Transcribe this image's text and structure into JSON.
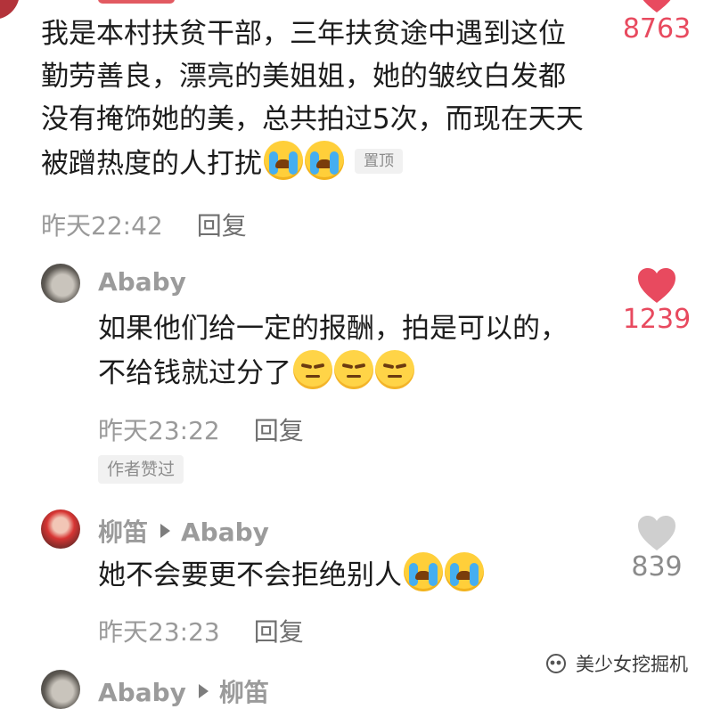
{
  "comments": [
    {
      "lines": [
        "我是本村扶贫干部，三年扶贫途中遇到这位",
        "勤劳善良，漂亮的美姐姐，她的皱纹白发都",
        "没有掩饰她的美，总共拍过5次，而现在天天",
        "被蹭热度的人打扰"
      ],
      "pin_label": "置顶",
      "time": "昨天22:42",
      "reply_label": "回复",
      "likes": "8763"
    },
    {
      "username": "Ababy",
      "lines": [
        "如果他们给一定的报酬，拍是可以的，",
        "不给钱就过分了"
      ],
      "time": "昨天23:22",
      "reply_label": "回复",
      "author_badge": "作者赞过",
      "likes": "1239"
    },
    {
      "username": "柳笛",
      "reply_to": "Ababy",
      "lines": [
        "她不会要更不会拒绝别人"
      ],
      "time": "昨天23:23",
      "reply_label": "回复",
      "likes": "839"
    },
    {
      "username": "Ababy",
      "reply_to": "柳笛"
    }
  ],
  "watermark": "美少女挖掘机",
  "icons": {
    "like_active": "heart-filled-red",
    "like_inactive": "heart-filled-gray",
    "emoji_cry": "loudly-crying-face",
    "emoji_smirk": "unamused-face",
    "watermark": "wechat-official-account-icon"
  },
  "colors": {
    "like_active": "#e84a5f",
    "like_inactive": "#cfcfcf",
    "meta_text": "#9a9a9a"
  }
}
